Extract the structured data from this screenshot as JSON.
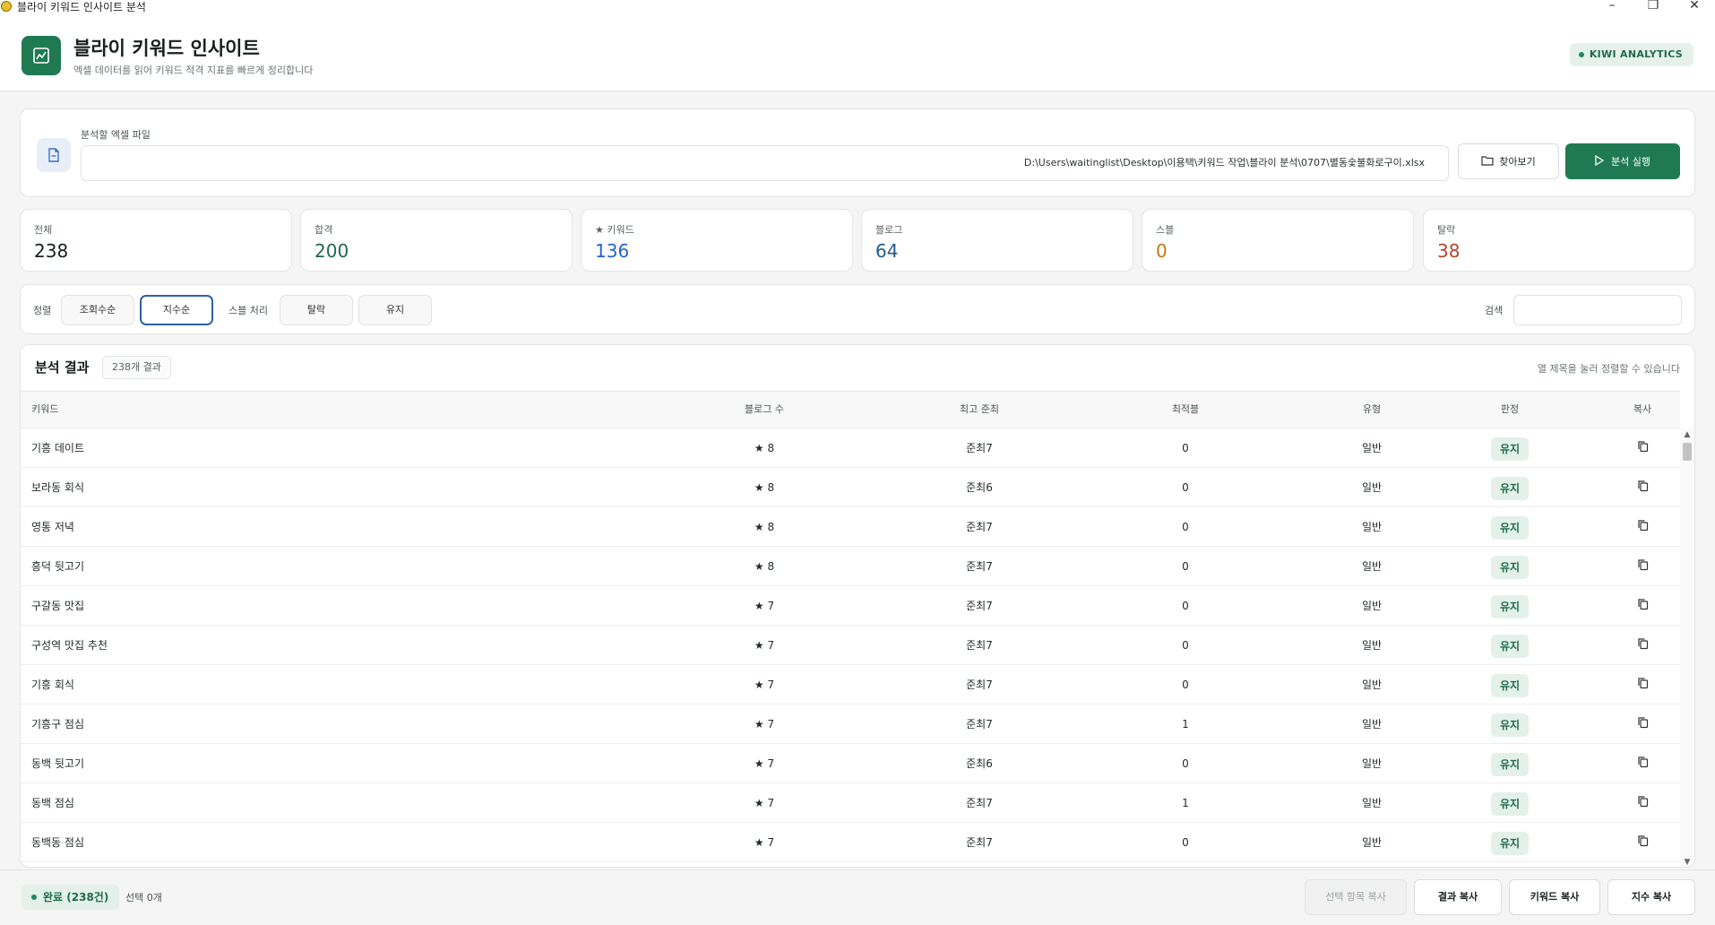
{
  "window": {
    "title": "블라이 키워드 인사이트 분석",
    "minimize": "–",
    "maximize": "❐",
    "close": "✕"
  },
  "header": {
    "title": "블라이 키워드 인사이트",
    "subtitle": "엑셀 데이터를 읽어 키워드 적격 지표를 빠르게 정리합니다",
    "badge": "KIWI ANALYTICS",
    "logo_icon": "chart-icon"
  },
  "file": {
    "label": "분석할 엑셀 파일",
    "path": "D:\\Users\\waitinglist\\Desktop\\이용택\\키워드 작업\\블라이 분석\\0707\\별동숯불화로구이.xlsx",
    "browse_label": "찾아보기",
    "run_label": "분석 실행"
  },
  "stats": [
    {
      "label": "전체",
      "value": "238"
    },
    {
      "label": "합격",
      "value": "200"
    },
    {
      "label": "★ 키워드",
      "value": "136"
    },
    {
      "label": "블로그",
      "value": "64"
    },
    {
      "label": "스블",
      "value": "0"
    },
    {
      "label": "탈락",
      "value": "38"
    }
  ],
  "filters": {
    "sort_label": "정렬",
    "sort_views": "조회수순",
    "sort_index": "지수순",
    "spam_label": "스블 처리",
    "spam_drop": "탈락",
    "spam_keep": "유지",
    "search_label": "검색",
    "search_value": ""
  },
  "results": {
    "title": "분석 결과",
    "count": "238개 결과",
    "hint": "열 제목을 눌러 정렬할 수 있습니다",
    "columns": {
      "keyword": "키워드",
      "blog": "블로그 수",
      "rank": "최고 준최",
      "optimal": "최적블",
      "type": "유형",
      "judge": "판정",
      "copy": "복사"
    },
    "rows": [
      {
        "keyword": "기흥 데이트",
        "blog": "★ 8",
        "rank": "준최7",
        "optimal": "0",
        "type": "일반",
        "judge": "유지"
      },
      {
        "keyword": "보라동 회식",
        "blog": "★ 8",
        "rank": "준최6",
        "optimal": "0",
        "type": "일반",
        "judge": "유지"
      },
      {
        "keyword": "영통 저녁",
        "blog": "★ 8",
        "rank": "준최7",
        "optimal": "0",
        "type": "일반",
        "judge": "유지"
      },
      {
        "keyword": "흥덕 뒷고기",
        "blog": "★ 8",
        "rank": "준최7",
        "optimal": "0",
        "type": "일반",
        "judge": "유지"
      },
      {
        "keyword": "구갈동 맛집",
        "blog": "★ 7",
        "rank": "준최7",
        "optimal": "0",
        "type": "일반",
        "judge": "유지"
      },
      {
        "keyword": "구성역 맛집 추천",
        "blog": "★ 7",
        "rank": "준최7",
        "optimal": "0",
        "type": "일반",
        "judge": "유지"
      },
      {
        "keyword": "기흥 회식",
        "blog": "★ 7",
        "rank": "준최7",
        "optimal": "0",
        "type": "일반",
        "judge": "유지"
      },
      {
        "keyword": "기흥구 점심",
        "blog": "★ 7",
        "rank": "준최7",
        "optimal": "1",
        "type": "일반",
        "judge": "유지"
      },
      {
        "keyword": "동백 뒷고기",
        "blog": "★ 7",
        "rank": "준최6",
        "optimal": "0",
        "type": "일반",
        "judge": "유지"
      },
      {
        "keyword": "동백 점심",
        "blog": "★ 7",
        "rank": "준최7",
        "optimal": "1",
        "type": "일반",
        "judge": "유지"
      },
      {
        "keyword": "동백동 점심",
        "blog": "★ 7",
        "rank": "준최7",
        "optimal": "0",
        "type": "일반",
        "judge": "유지"
      }
    ]
  },
  "footer": {
    "status": "완료 (238건)",
    "selected": "선택 0개",
    "copy_selected": "선택 항목 복사",
    "copy_results": "결과 복사",
    "copy_keywords": "키워드 복사",
    "copy_index": "지수 복사"
  },
  "colors": {
    "accent": "#1f7a52",
    "pass": "#1f6b4a",
    "keyword": "#2563c9",
    "spam": "#c27812",
    "drop": "#b5452b"
  }
}
